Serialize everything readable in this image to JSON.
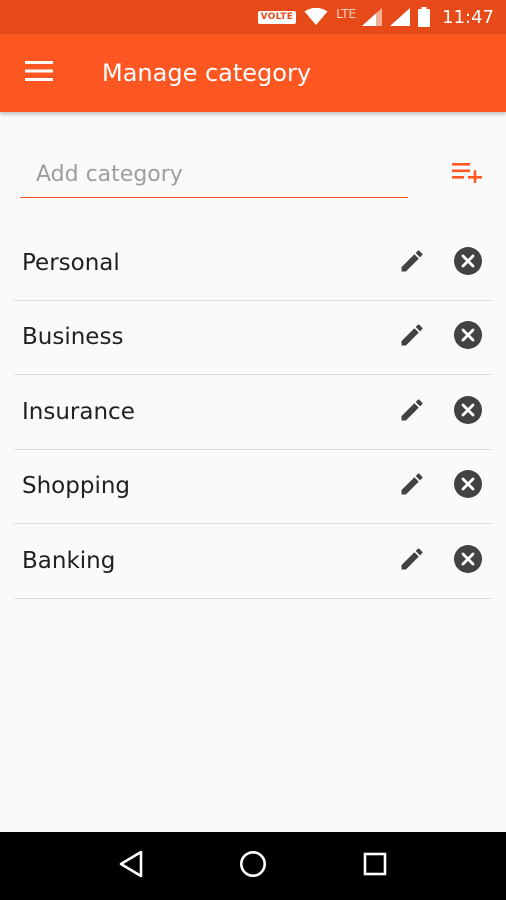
{
  "status_bar": {
    "volte": "VOLTE",
    "network": "LTE",
    "time": "11:47"
  },
  "app_bar": {
    "title": "Manage category",
    "menu_icon": "hamburger-menu-icon"
  },
  "add_category": {
    "placeholder": "Add category",
    "value": "",
    "add_icon": "playlist-add-icon"
  },
  "categories": [
    {
      "label": "Personal"
    },
    {
      "label": "Business"
    },
    {
      "label": "Insurance"
    },
    {
      "label": "Shopping"
    },
    {
      "label": "Banking"
    }
  ],
  "row_icons": {
    "edit": "pencil-icon",
    "delete": "close-circle-icon"
  },
  "nav_bar": {
    "back": "back-triangle-icon",
    "home": "home-circle-icon",
    "recents": "recents-square-icon"
  },
  "colors": {
    "primary": "#FF5722",
    "primary_dark": "#E64A19",
    "background": "#FAFAFA",
    "text": "#212121",
    "icon": "#424242"
  }
}
